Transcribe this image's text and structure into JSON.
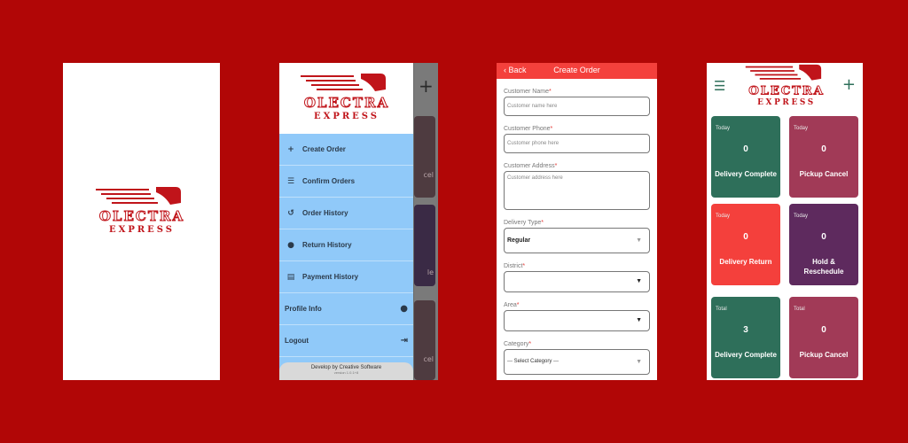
{
  "colors": {
    "background": "#b10606",
    "brand_red": "#c0141a",
    "drawer_blue": "#90c9f9",
    "header_red": "#f4403c",
    "green": "#2e6f5a",
    "maroon": "#a13a57",
    "red": "#f4403c",
    "purple": "#5e2a5e"
  },
  "logo": {
    "line1": "OLECTRA",
    "line2": "EXPRESS"
  },
  "drawer": {
    "items": [
      {
        "label": "Create Order",
        "icon": "plus-icon"
      },
      {
        "label": "Confirm Orders",
        "icon": "list-icon"
      },
      {
        "label": "Order History",
        "icon": "history-icon"
      },
      {
        "label": "Return History",
        "icon": "alert-icon"
      },
      {
        "label": "Payment History",
        "icon": "payment-icon"
      }
    ],
    "profile_label": "Profile Info",
    "logout_label": "Logout",
    "footer": "Develop by Creative Software",
    "version": "version 1.0.1+8",
    "underlay_fragments": [
      "cel",
      "le",
      "cel"
    ]
  },
  "create_order": {
    "back_label": "Back",
    "title": "Create Order",
    "customer_name_label": "Customer Name",
    "customer_name_placeholder": "Customer name here",
    "customer_phone_label": "Customer Phone",
    "customer_phone_placeholder": "Customer phone here",
    "customer_address_label": "Customer Address",
    "customer_address_placeholder": "Customer address here",
    "delivery_type_label": "Delivery Type",
    "delivery_type_value": "Regular",
    "district_label": "District",
    "district_value": "",
    "area_label": "Area",
    "area_value": "",
    "category_label": "Category",
    "category_value": "--- Select Category ---",
    "required_mark": "*"
  },
  "dashboard": {
    "cards": [
      {
        "caption": "Today",
        "value": "0",
        "label": "Delivery Complete",
        "color": "#2e6f5a"
      },
      {
        "caption": "Today",
        "value": "0",
        "label": "Pickup Cancel",
        "color": "#a13a57"
      },
      {
        "caption": "Today",
        "value": "0",
        "label": "Delivery Return",
        "color": "#f4403c"
      },
      {
        "caption": "Today",
        "value": "0",
        "label": "Hold & Reschedule",
        "color": "#5e2a5e"
      },
      {
        "caption": "Total",
        "value": "3",
        "label": "Delivery Complete",
        "color": "#2e6f5a"
      },
      {
        "caption": "Total",
        "value": "0",
        "label": "Pickup Cancel",
        "color": "#a13a57"
      }
    ]
  }
}
